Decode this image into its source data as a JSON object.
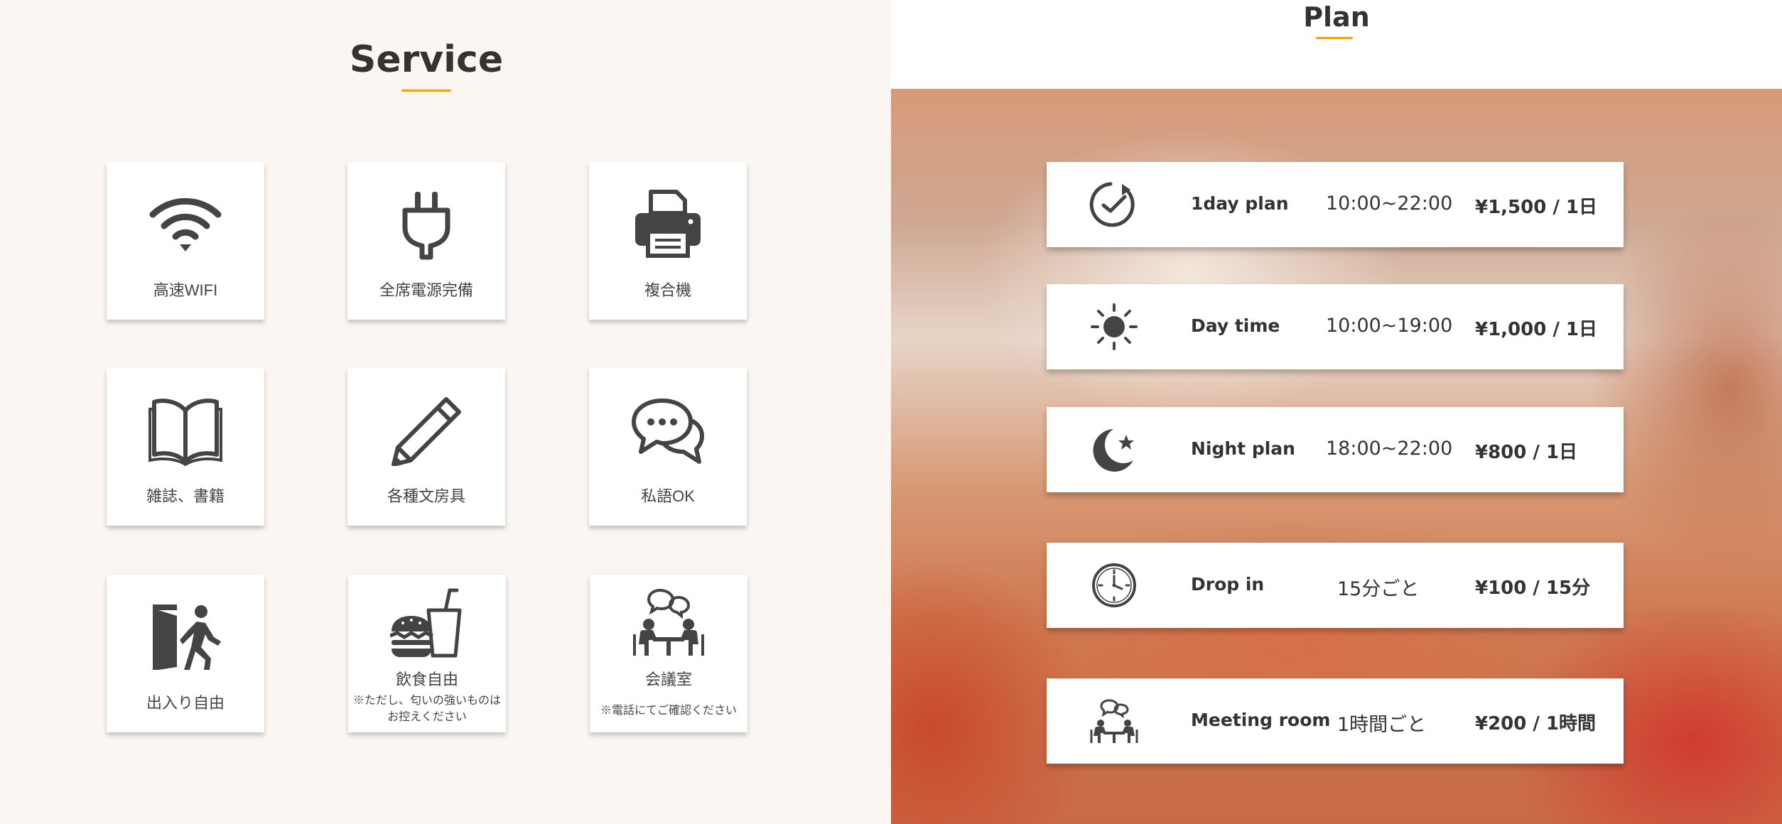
{
  "service": {
    "title": "Service",
    "accent_color": "#f0a020",
    "items": [
      {
        "icon": "wifi-icon",
        "label": "高速WIFI"
      },
      {
        "icon": "plug-icon",
        "label": "全席電源完備"
      },
      {
        "icon": "printer-icon",
        "label": "複合機"
      },
      {
        "icon": "book-icon",
        "label": "雑誌、書籍"
      },
      {
        "icon": "pencil-icon",
        "label": "各種文房具"
      },
      {
        "icon": "chat-bubbles-icon",
        "label": "私語OK"
      },
      {
        "icon": "exit-door-icon",
        "label": "出入り自由"
      },
      {
        "icon": "burger-drink-icon",
        "label": "飲食自由",
        "note_line1": "※ただし、匂いの強いものは",
        "note_line2": "お控えください"
      },
      {
        "icon": "meeting-icon",
        "label": "会議室",
        "note_line1": "※電話にてご確認ください"
      }
    ]
  },
  "plan": {
    "title": "Plan",
    "accent_color": "#f0a020",
    "items": [
      {
        "icon": "clock-check-icon",
        "name": "1day plan",
        "time": "10:00~22:00",
        "price": "¥1,500 / 1日"
      },
      {
        "icon": "sun-icon",
        "name": "Day time",
        "time": "10:00~19:00",
        "price": "¥1,000 / 1日"
      },
      {
        "icon": "moon-star-icon",
        "name": "Night plan",
        "time": "18:00~22:00",
        "price": "¥800 / 1日"
      },
      {
        "icon": "clock-icon",
        "name": "Drop in",
        "time": "15分ごと",
        "price": "¥100 / 15分"
      },
      {
        "icon": "meeting-icon",
        "name": "Meeting room",
        "time": "1時間ごと",
        "price": "¥200 / 1時間"
      }
    ]
  }
}
